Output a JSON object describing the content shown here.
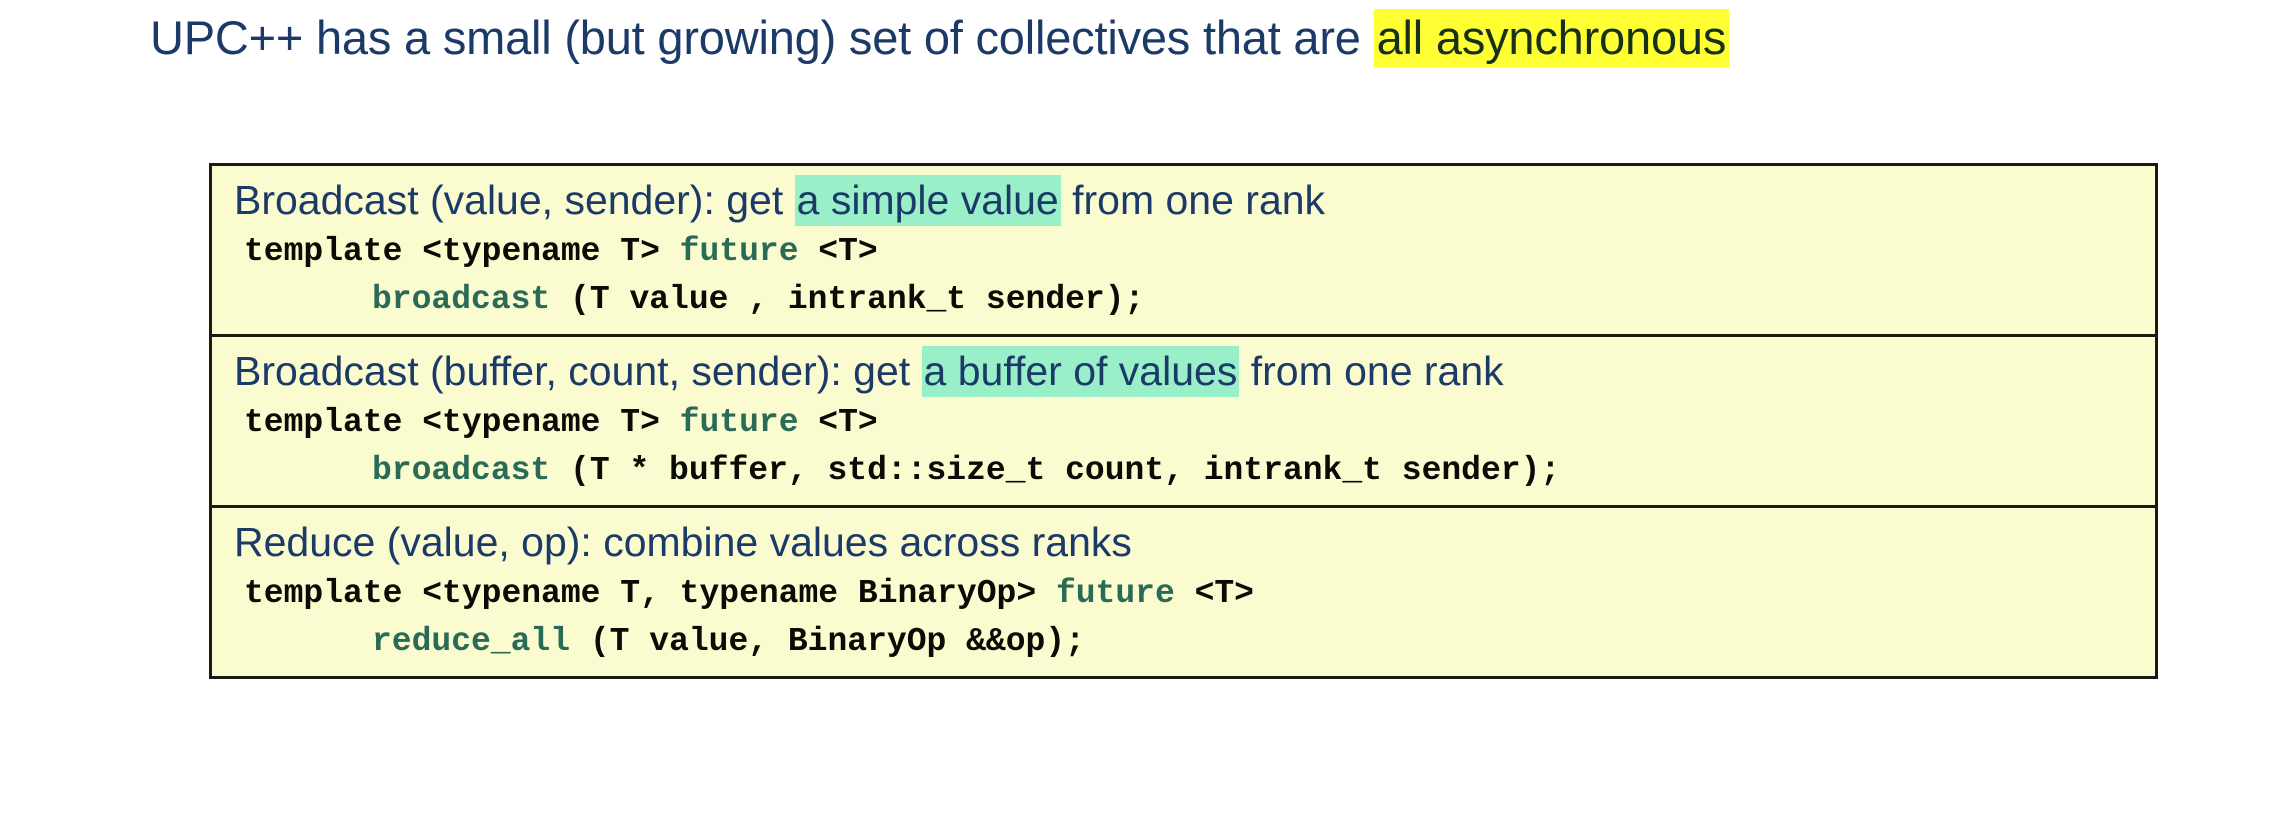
{
  "slide": {
    "title_prefix": "UPC++ has a small (but growing) set of collectives that are ",
    "title_highlight": "all asynchronous",
    "colors": {
      "title_text": "#1b3a68",
      "yellow_highlight": "#ffff33",
      "mint_highlight": "#99f0c8",
      "box_background": "#fbfbd0",
      "box_border": "#1a1a12",
      "code_text": "#0b0b05",
      "code_keyword": "#2a6b57",
      "page_background": "#ffffff"
    }
  },
  "collectives": [
    {
      "heading_prefix": "Broadcast (value, sender): get ",
      "heading_highlight": "a simple value",
      "heading_suffix": " from one rank",
      "code": {
        "line1_pre": "template <typename T> ",
        "line1_kw": "future",
        "line1_post": " <T>",
        "line2_fn": "broadcast",
        "line2_post": " (T value , intrank_t sender);"
      }
    },
    {
      "heading_prefix": "Broadcast (buffer, count, sender): get ",
      "heading_highlight": "a buffer of values",
      "heading_suffix": " from one rank",
      "code": {
        "line1_pre": "template <typename T> ",
        "line1_kw": "future",
        "line1_post": " <T>",
        "line2_fn": "broadcast",
        "line2_post": " (T * buffer, std::size_t count, intrank_t sender);"
      }
    },
    {
      "heading_prefix": "Reduce (value, op): combine values across ranks",
      "heading_highlight": "",
      "heading_suffix": "",
      "code": {
        "line1_pre": "template <typename T, typename BinaryOp> ",
        "line1_kw": "future",
        "line1_post": " <T>",
        "line2_fn": "reduce_all",
        "line2_post": " (T value, BinaryOp &&op);"
      }
    }
  ]
}
